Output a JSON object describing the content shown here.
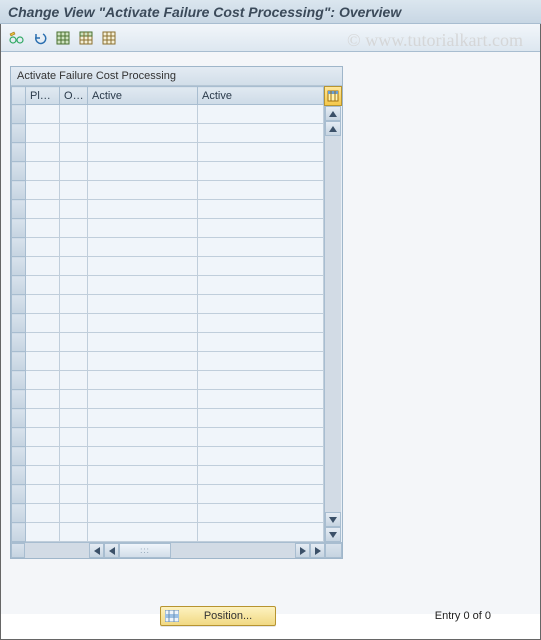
{
  "header": {
    "title": "Change View \"Activate Failure Cost Processing\": Overview"
  },
  "watermark": "© www.tutorialkart.com",
  "toolbar": {
    "buttons": [
      {
        "name": "change-display-icon"
      },
      {
        "name": "undo-icon"
      },
      {
        "name": "select-all-icon"
      },
      {
        "name": "select-block-icon"
      },
      {
        "name": "deselect-all-icon"
      }
    ]
  },
  "panel": {
    "title": "Activate Failure Cost Processing",
    "columns": [
      "Plant",
      "Or...",
      "Active",
      "Active"
    ],
    "row_count": 23,
    "config_button": "configure-columns"
  },
  "footer": {
    "position_label": "Position...",
    "entry_text": "Entry 0 of 0"
  }
}
